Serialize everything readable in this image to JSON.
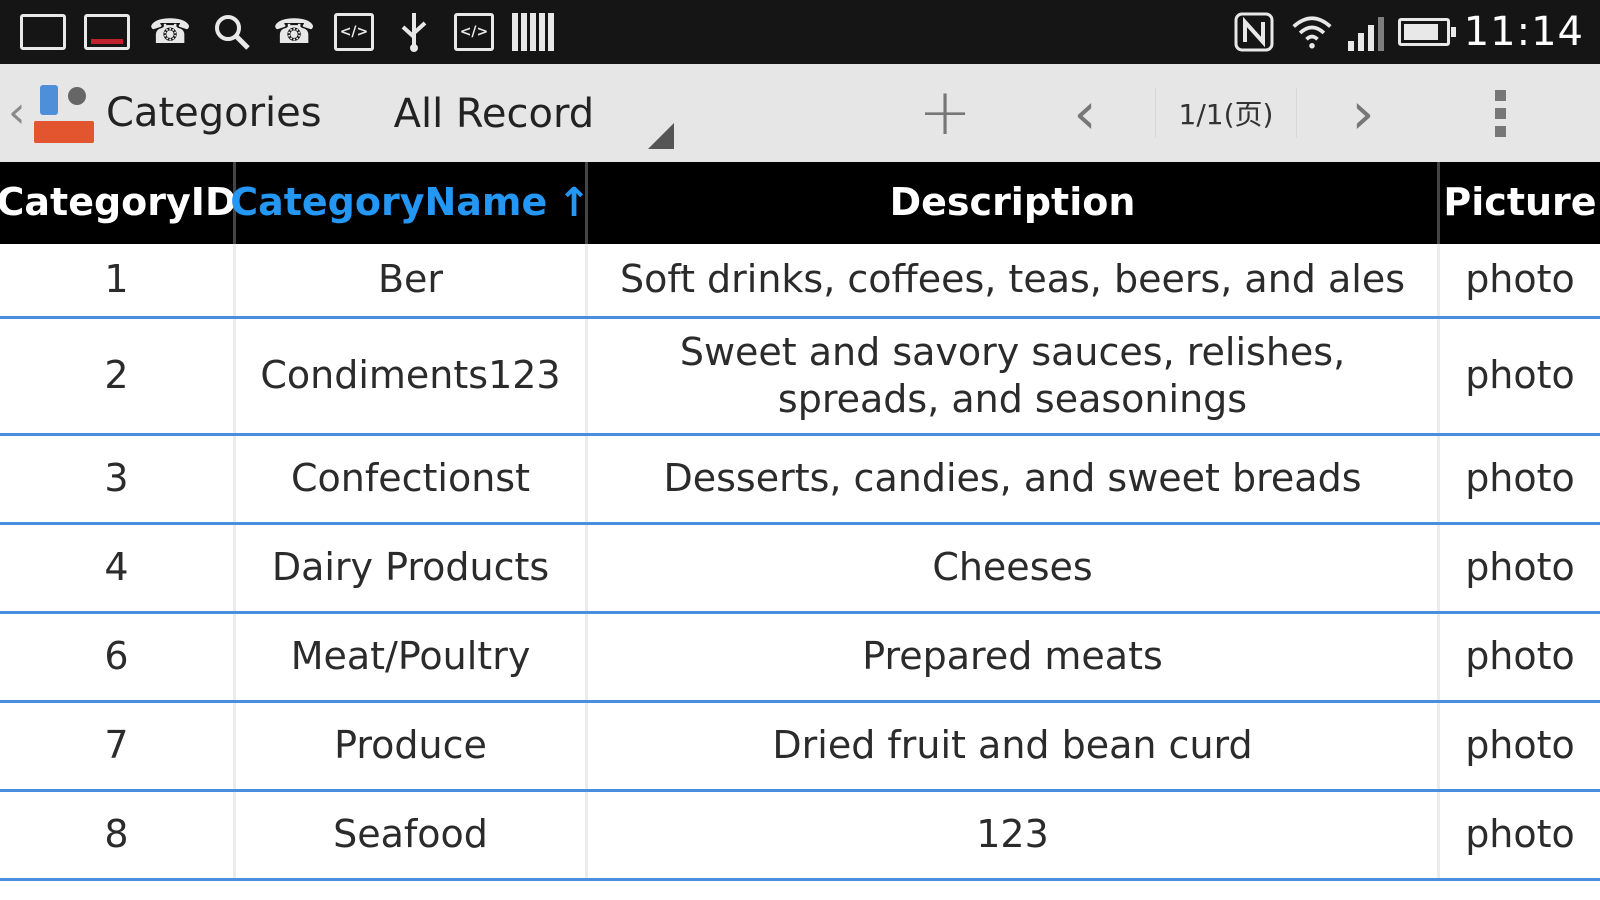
{
  "status_bar": {
    "time": "11:14",
    "notification_icons": [
      "screen-icon",
      "recorder-icon",
      "phone-icon",
      "search-settings-icon",
      "phone-icon",
      "code-icon",
      "usb-icon",
      "code-icon",
      "barcode-icon"
    ],
    "system_icons": [
      "nfc-icon",
      "wifi-icon",
      "signal-icon",
      "battery-charging-icon"
    ]
  },
  "action_bar": {
    "title": "Categories",
    "spinner_value": "All Record",
    "page_indicator": "1/1(页)",
    "add_label": "+",
    "prev_label": "‹",
    "next_label": "›"
  },
  "table": {
    "columns": [
      {
        "label": "CategoryID",
        "sorted": false
      },
      {
        "label": "CategoryName",
        "sorted": true,
        "sort_dir": "↑"
      },
      {
        "label": "Description",
        "sorted": false
      },
      {
        "label": "Picture",
        "sorted": false
      }
    ],
    "rows": [
      {
        "id": "1",
        "name": "Ber",
        "description": "Soft drinks, coffees, teas, beers, and ales",
        "picture": "photo"
      },
      {
        "id": "2",
        "name": "Condiments123",
        "description": "Sweet and savory sauces, relishes, spreads, and seasonings",
        "picture": "photo"
      },
      {
        "id": "3",
        "name": "Confectionst",
        "description": "Desserts, candies, and sweet breads",
        "picture": "photo"
      },
      {
        "id": "4",
        "name": "Dairy Products",
        "description": "Cheeses",
        "picture": "photo"
      },
      {
        "id": "6",
        "name": "Meat/Poultry",
        "description": "Prepared meats",
        "picture": "photo"
      },
      {
        "id": "7",
        "name": "Produce",
        "description": "Dried fruit and bean curd",
        "picture": "photo"
      },
      {
        "id": "8",
        "name": "Seafood",
        "description": "123",
        "picture": "photo"
      }
    ]
  },
  "colors": {
    "status_bar_bg": "#151515",
    "action_bar_bg": "#e6e6e6",
    "header_bg": "#000000",
    "sorted_header": "#2496f3",
    "row_divider": "#4a8ee0"
  }
}
